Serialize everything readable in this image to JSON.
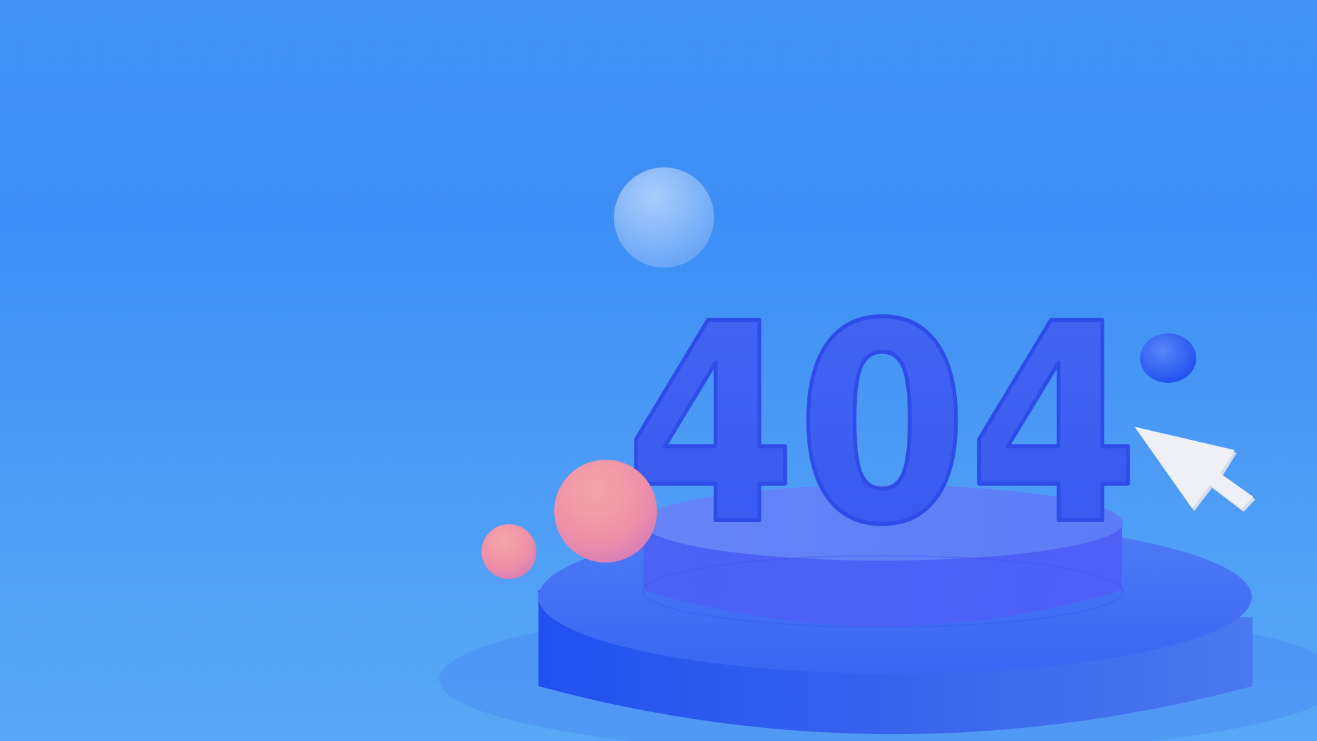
{
  "error_code": "404",
  "colors": {
    "background": "#4292f5",
    "digits": "#3c5df0",
    "podium": "#3b5cf2",
    "podium_top": "#5b7cf6",
    "pink_sphere": "#f29ab0",
    "light_sphere": "#8dbcf8",
    "dark_sphere": "#2f5cf0",
    "cursor": "#eef0f6"
  },
  "icons": {
    "cursor": "mouse-pointer-icon"
  }
}
